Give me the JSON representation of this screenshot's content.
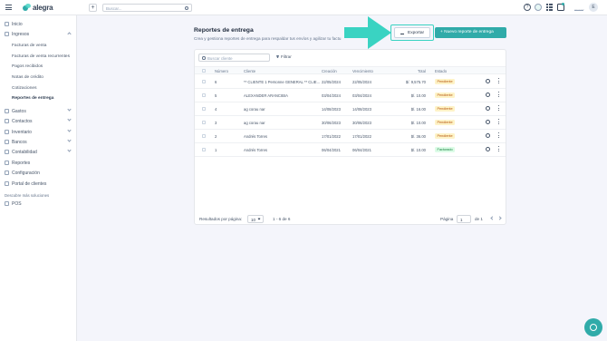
{
  "topbar": {
    "logo_text": "alegra",
    "search_placeholder": "Buscar...",
    "company_name": "..........",
    "user_initial": "E"
  },
  "sidebar": {
    "items": [
      {
        "label": "Inicio",
        "icon": "home-icon"
      },
      {
        "label": "Ingresos",
        "icon": "income-icon"
      },
      {
        "label": "Gastos",
        "icon": "expenses-icon"
      },
      {
        "label": "Contactos",
        "icon": "contacts-icon"
      },
      {
        "label": "Inventario",
        "icon": "inventory-icon"
      },
      {
        "label": "Bancos",
        "icon": "bank-icon"
      },
      {
        "label": "Contabilidad",
        "icon": "accounting-icon"
      },
      {
        "label": "Reportes",
        "icon": "reports-icon"
      },
      {
        "label": "Configuración",
        "icon": "gear-icon"
      },
      {
        "label": "Portal de clientes",
        "icon": "portal-icon"
      }
    ],
    "ingresos_sub": [
      "Facturas de venta",
      "Facturas de venta recurrentes",
      "Pagos recibidos",
      "Notas de crédito",
      "Cotizaciones",
      "Reportes de entrega"
    ],
    "section_label": "Descubre más soluciones",
    "pos_label": "POS"
  },
  "page": {
    "title": "Reportes de entrega",
    "subtitle": "Crea y gestiona reportes de entrega para respaldar tus envíos y agilizar tu factu",
    "export_label": "Exportar",
    "new_label": "Nuevo reporte de entrega"
  },
  "table": {
    "search_placeholder": "Buscar cliente",
    "filter_label": "Filtrar",
    "headers": [
      "Número",
      "Cliente",
      "Creación",
      "Vencimiento",
      "Total",
      "Estado"
    ],
    "rows": [
      {
        "num": "6",
        "client": "** CLIENTE 1 Personne GENERAL ** CLIE...",
        "created": "22/05/2024",
        "due": "22/05/2024",
        "total": "$/. 9,575.70",
        "status": "Pendiente"
      },
      {
        "num": "5",
        "client": "ALEXANDER ARANCIBIA",
        "created": "03/04/2024",
        "due": "03/04/2024",
        "total": "$/. 10.00",
        "status": "Pendiente"
      },
      {
        "num": "4",
        "client": "ag corau nar",
        "created": "14/08/2023",
        "due": "14/08/2023",
        "total": "$/. 16.00",
        "status": "Pendiente"
      },
      {
        "num": "3",
        "client": "ag corau nar",
        "created": "30/06/2023",
        "due": "30/06/2023",
        "total": "$/. 10.00",
        "status": "Pendiente"
      },
      {
        "num": "2",
        "client": "Andrés Torres",
        "created": "17/01/2022",
        "due": "17/01/2022",
        "total": "$/. 36.00",
        "status": "Pendiente"
      },
      {
        "num": "1",
        "client": "Andrés Torres",
        "created": "06/04/2021",
        "due": "06/04/2021",
        "total": "$/. 10.00",
        "status": "Facturado"
      }
    ],
    "footer": {
      "per_page_label": "Resultados por página:",
      "per_page_value": "10",
      "range": "1 - 6 de 6",
      "page_label": "Página",
      "page_value": "1",
      "of_label": "de 1"
    }
  },
  "colors": {
    "brand": "#30aba9",
    "highlight": "#3ad3c2",
    "pending_bg": "#fef3c7",
    "invoiced_bg": "#dcfce7"
  }
}
